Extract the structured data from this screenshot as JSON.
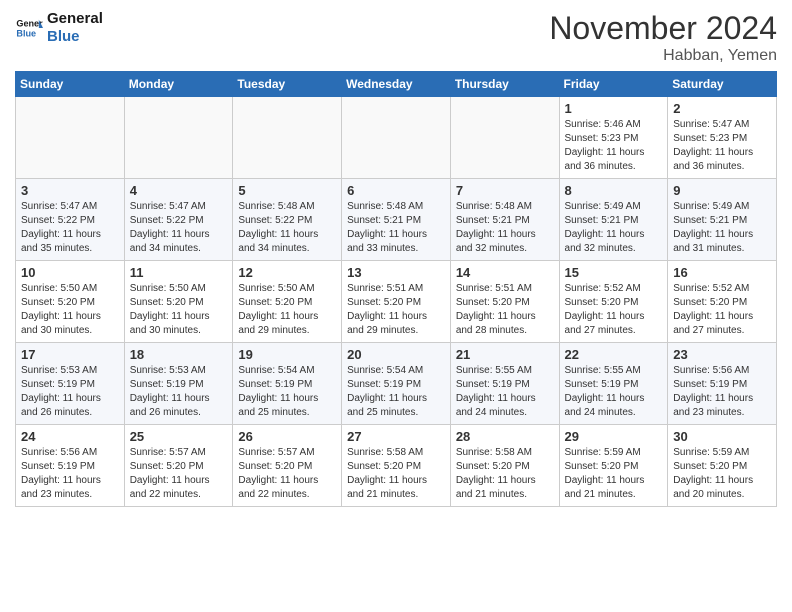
{
  "header": {
    "logo_line1": "General",
    "logo_line2": "Blue",
    "month": "November 2024",
    "location": "Habban, Yemen"
  },
  "days_of_week": [
    "Sunday",
    "Monday",
    "Tuesday",
    "Wednesday",
    "Thursday",
    "Friday",
    "Saturday"
  ],
  "weeks": [
    [
      {
        "day": "",
        "info": ""
      },
      {
        "day": "",
        "info": ""
      },
      {
        "day": "",
        "info": ""
      },
      {
        "day": "",
        "info": ""
      },
      {
        "day": "",
        "info": ""
      },
      {
        "day": "1",
        "info": "Sunrise: 5:46 AM\nSunset: 5:23 PM\nDaylight: 11 hours\nand 36 minutes."
      },
      {
        "day": "2",
        "info": "Sunrise: 5:47 AM\nSunset: 5:23 PM\nDaylight: 11 hours\nand 36 minutes."
      }
    ],
    [
      {
        "day": "3",
        "info": "Sunrise: 5:47 AM\nSunset: 5:22 PM\nDaylight: 11 hours\nand 35 minutes."
      },
      {
        "day": "4",
        "info": "Sunrise: 5:47 AM\nSunset: 5:22 PM\nDaylight: 11 hours\nand 34 minutes."
      },
      {
        "day": "5",
        "info": "Sunrise: 5:48 AM\nSunset: 5:22 PM\nDaylight: 11 hours\nand 34 minutes."
      },
      {
        "day": "6",
        "info": "Sunrise: 5:48 AM\nSunset: 5:21 PM\nDaylight: 11 hours\nand 33 minutes."
      },
      {
        "day": "7",
        "info": "Sunrise: 5:48 AM\nSunset: 5:21 PM\nDaylight: 11 hours\nand 32 minutes."
      },
      {
        "day": "8",
        "info": "Sunrise: 5:49 AM\nSunset: 5:21 PM\nDaylight: 11 hours\nand 32 minutes."
      },
      {
        "day": "9",
        "info": "Sunrise: 5:49 AM\nSunset: 5:21 PM\nDaylight: 11 hours\nand 31 minutes."
      }
    ],
    [
      {
        "day": "10",
        "info": "Sunrise: 5:50 AM\nSunset: 5:20 PM\nDaylight: 11 hours\nand 30 minutes."
      },
      {
        "day": "11",
        "info": "Sunrise: 5:50 AM\nSunset: 5:20 PM\nDaylight: 11 hours\nand 30 minutes."
      },
      {
        "day": "12",
        "info": "Sunrise: 5:50 AM\nSunset: 5:20 PM\nDaylight: 11 hours\nand 29 minutes."
      },
      {
        "day": "13",
        "info": "Sunrise: 5:51 AM\nSunset: 5:20 PM\nDaylight: 11 hours\nand 29 minutes."
      },
      {
        "day": "14",
        "info": "Sunrise: 5:51 AM\nSunset: 5:20 PM\nDaylight: 11 hours\nand 28 minutes."
      },
      {
        "day": "15",
        "info": "Sunrise: 5:52 AM\nSunset: 5:20 PM\nDaylight: 11 hours\nand 27 minutes."
      },
      {
        "day": "16",
        "info": "Sunrise: 5:52 AM\nSunset: 5:20 PM\nDaylight: 11 hours\nand 27 minutes."
      }
    ],
    [
      {
        "day": "17",
        "info": "Sunrise: 5:53 AM\nSunset: 5:19 PM\nDaylight: 11 hours\nand 26 minutes."
      },
      {
        "day": "18",
        "info": "Sunrise: 5:53 AM\nSunset: 5:19 PM\nDaylight: 11 hours\nand 26 minutes."
      },
      {
        "day": "19",
        "info": "Sunrise: 5:54 AM\nSunset: 5:19 PM\nDaylight: 11 hours\nand 25 minutes."
      },
      {
        "day": "20",
        "info": "Sunrise: 5:54 AM\nSunset: 5:19 PM\nDaylight: 11 hours\nand 25 minutes."
      },
      {
        "day": "21",
        "info": "Sunrise: 5:55 AM\nSunset: 5:19 PM\nDaylight: 11 hours\nand 24 minutes."
      },
      {
        "day": "22",
        "info": "Sunrise: 5:55 AM\nSunset: 5:19 PM\nDaylight: 11 hours\nand 24 minutes."
      },
      {
        "day": "23",
        "info": "Sunrise: 5:56 AM\nSunset: 5:19 PM\nDaylight: 11 hours\nand 23 minutes."
      }
    ],
    [
      {
        "day": "24",
        "info": "Sunrise: 5:56 AM\nSunset: 5:19 PM\nDaylight: 11 hours\nand 23 minutes."
      },
      {
        "day": "25",
        "info": "Sunrise: 5:57 AM\nSunset: 5:20 PM\nDaylight: 11 hours\nand 22 minutes."
      },
      {
        "day": "26",
        "info": "Sunrise: 5:57 AM\nSunset: 5:20 PM\nDaylight: 11 hours\nand 22 minutes."
      },
      {
        "day": "27",
        "info": "Sunrise: 5:58 AM\nSunset: 5:20 PM\nDaylight: 11 hours\nand 21 minutes."
      },
      {
        "day": "28",
        "info": "Sunrise: 5:58 AM\nSunset: 5:20 PM\nDaylight: 11 hours\nand 21 minutes."
      },
      {
        "day": "29",
        "info": "Sunrise: 5:59 AM\nSunset: 5:20 PM\nDaylight: 11 hours\nand 21 minutes."
      },
      {
        "day": "30",
        "info": "Sunrise: 5:59 AM\nSunset: 5:20 PM\nDaylight: 11 hours\nand 20 minutes."
      }
    ]
  ]
}
